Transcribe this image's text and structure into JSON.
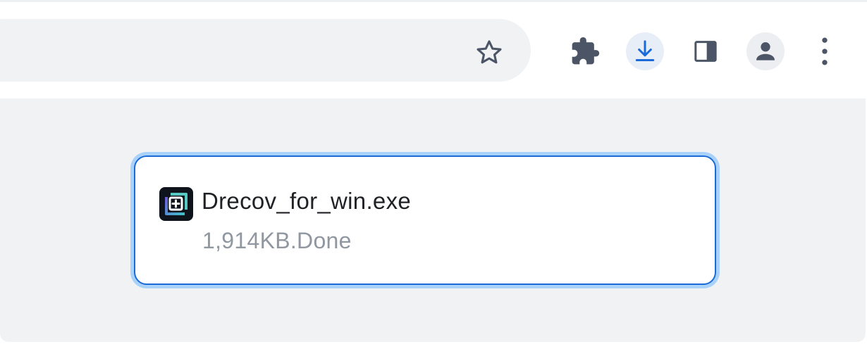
{
  "toolbar": {
    "icons": {
      "bookmark": "star-icon",
      "extensions": "puzzle-icon",
      "downloads": "download-icon",
      "side_panel": "side-panel-icon",
      "profile": "person-icon",
      "menu": "more-vert-icon"
    },
    "colors": {
      "icon": "#4b5565",
      "download_accent": "#1a6ad8"
    }
  },
  "download": {
    "file_name": "Drecov_for_win.exe",
    "status": "1,914KB.Done",
    "icon": "drecov-app-icon",
    "colors": {
      "border": "#1a6ad8",
      "focus_ring": "#a9d2fb",
      "status_text": "#9097a0"
    }
  }
}
